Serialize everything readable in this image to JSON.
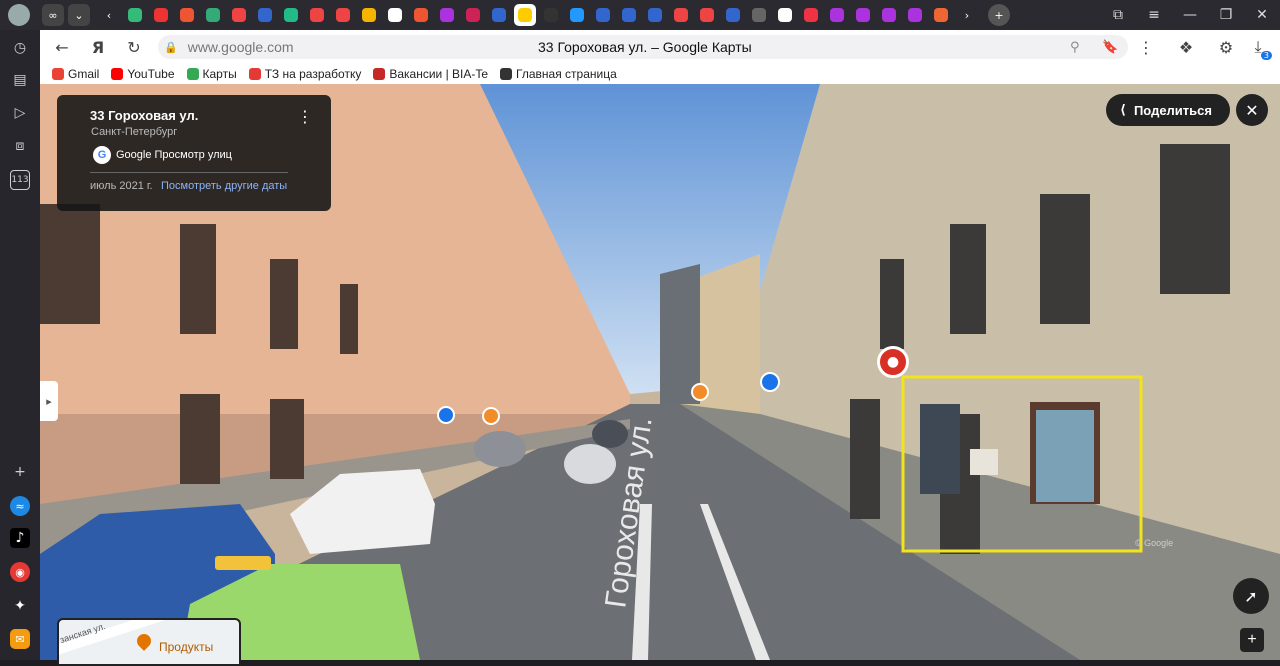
{
  "browser": {
    "tabs_active_index": 15,
    "url": "www.google.com",
    "page_title": "33 Гороховая ул. – Google Карты",
    "sidebar_badge": "113",
    "notifications_badge": "3"
  },
  "bookmarks": [
    {
      "label": "Gmail",
      "color": "#ea4335"
    },
    {
      "label": "YouTube",
      "color": "#ff0000"
    },
    {
      "label": "Карты",
      "color": "#34a853"
    },
    {
      "label": "ТЗ на разработку",
      "color": "#e53935"
    },
    {
      "label": "Вакансии | BIA-Te",
      "color": "#c62828"
    },
    {
      "label": "Главная страница",
      "color": "#333333"
    }
  ],
  "streetview": {
    "title": "33 Гороховая ул.",
    "subtitle": "Санкт-Петербург",
    "source": "Google Просмотр улиц",
    "date": "июль 2021 г.",
    "other_dates_link": "Посмотреть другие даты",
    "share_label": "Поделиться",
    "street_label": "Гороховая ул.",
    "watermark": "© Google",
    "minimap_label": "Продукты",
    "minimap_street": "занская ул."
  },
  "colors": {
    "highlight": "#f2e41a",
    "accent_blue": "#1a73e8",
    "pin_red": "#d93025"
  }
}
